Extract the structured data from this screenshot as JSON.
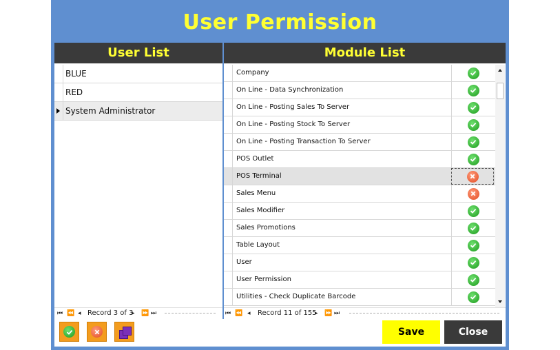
{
  "window": {
    "title": "User Permission"
  },
  "user_list": {
    "header": "User List",
    "users": [
      {
        "name": "BLUE"
      },
      {
        "name": "RED"
      },
      {
        "name": "System Administrator"
      }
    ],
    "selected_index": 2,
    "record_text": "Record 3 of 3"
  },
  "module_list": {
    "header": "Module List",
    "modules": [
      {
        "name": "Company",
        "allowed": true
      },
      {
        "name": "On Line - Data Synchronization",
        "allowed": true
      },
      {
        "name": "On Line - Posting Sales To Server",
        "allowed": true
      },
      {
        "name": "On Line - Posting Stock To Server",
        "allowed": true
      },
      {
        "name": "On Line - Posting Transaction To Server",
        "allowed": true
      },
      {
        "name": "POS Outlet",
        "allowed": true
      },
      {
        "name": "POS Terminal",
        "allowed": false
      },
      {
        "name": "Sales Menu",
        "allowed": false
      },
      {
        "name": "Sales Modifier",
        "allowed": true
      },
      {
        "name": "Sales Promotions",
        "allowed": true
      },
      {
        "name": "Table Layout",
        "allowed": true
      },
      {
        "name": "User",
        "allowed": true
      },
      {
        "name": "User Permission",
        "allowed": true
      },
      {
        "name": "Utilities - Check Duplicate Barcode",
        "allowed": true
      }
    ],
    "selected_index": 6,
    "record_text": "Record 11 of 155"
  },
  "icons": {
    "allowed": "check-circle-icon",
    "denied": "cross-circle-icon",
    "toolbar": [
      "check-all-icon",
      "uncheck-all-icon",
      "copy-permission-icon"
    ]
  },
  "footer": {
    "save_label": "Save",
    "close_label": "Close"
  },
  "colors": {
    "title_text": "#ffff33",
    "window_bg": "#5f8fd0",
    "header_bg": "#3a3a3a",
    "allowed": "#1d9a1d",
    "denied": "#e24b22",
    "save_bg": "#ffff00",
    "close_bg": "#3a3a3a",
    "toolbar_button": "#f39c1e"
  }
}
